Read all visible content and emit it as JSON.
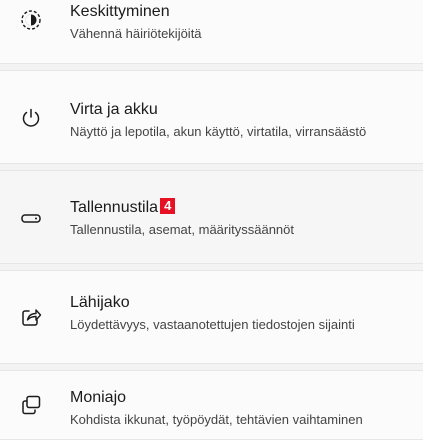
{
  "items": [
    {
      "icon": "focus-icon",
      "title": "Keskittyminen",
      "subtitle": "Vähennä häiriötekijöitä"
    },
    {
      "icon": "power-icon",
      "title": "Virta ja akku",
      "subtitle": "Näyttö ja lepotila, akun käyttö, virtatila, virransäästö"
    },
    {
      "icon": "storage-icon",
      "title": "Tallennustila",
      "badge": "4",
      "subtitle": "Tallennustila, asemat, määrityssäännöt"
    },
    {
      "icon": "share-icon",
      "title": "Lähijako",
      "subtitle": "Löydettävyys, vastaanotettujen tiedostojen sijainti"
    },
    {
      "icon": "multitasking-icon",
      "title": "Moniajo",
      "subtitle": "Kohdista ikkunat, työpöydät, tehtävien vaihtaminen"
    }
  ],
  "colors": {
    "badge": "#e81123",
    "background": "#f3f3f3",
    "card": "#fbfbfb"
  }
}
